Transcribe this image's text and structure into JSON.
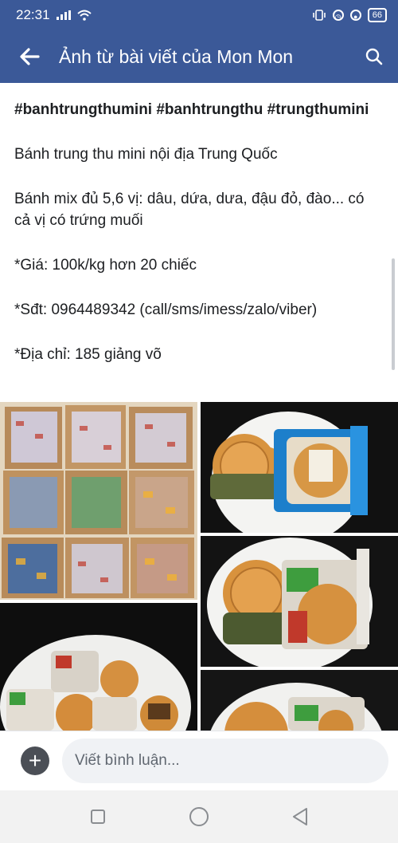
{
  "status_bar": {
    "time": "22:31",
    "battery": "66"
  },
  "header": {
    "title": "Ảnh từ bài viết của Mon Mon"
  },
  "post": {
    "tags": "#banhtrungthumini #banhtrungthu #trungthumini",
    "lines": [
      "Bánh trung thu mini nội địa Trung Quốc",
      "Bánh mix đủ 5,6 vị: dâu, dứa, dưa, đậu đỏ, đào... có cả vị có trứng muối",
      "*Giá: 100k/kg hơn 20 chiếc",
      "*Sđt: 0964489342 (call/sms/imess/zalo/viber)",
      "*Địa chỉ: 185 giảng võ"
    ]
  },
  "comment": {
    "placeholder": "Viết bình luận..."
  },
  "colors": {
    "brand": "#3b5998",
    "input_bg": "#f0f2f5"
  }
}
